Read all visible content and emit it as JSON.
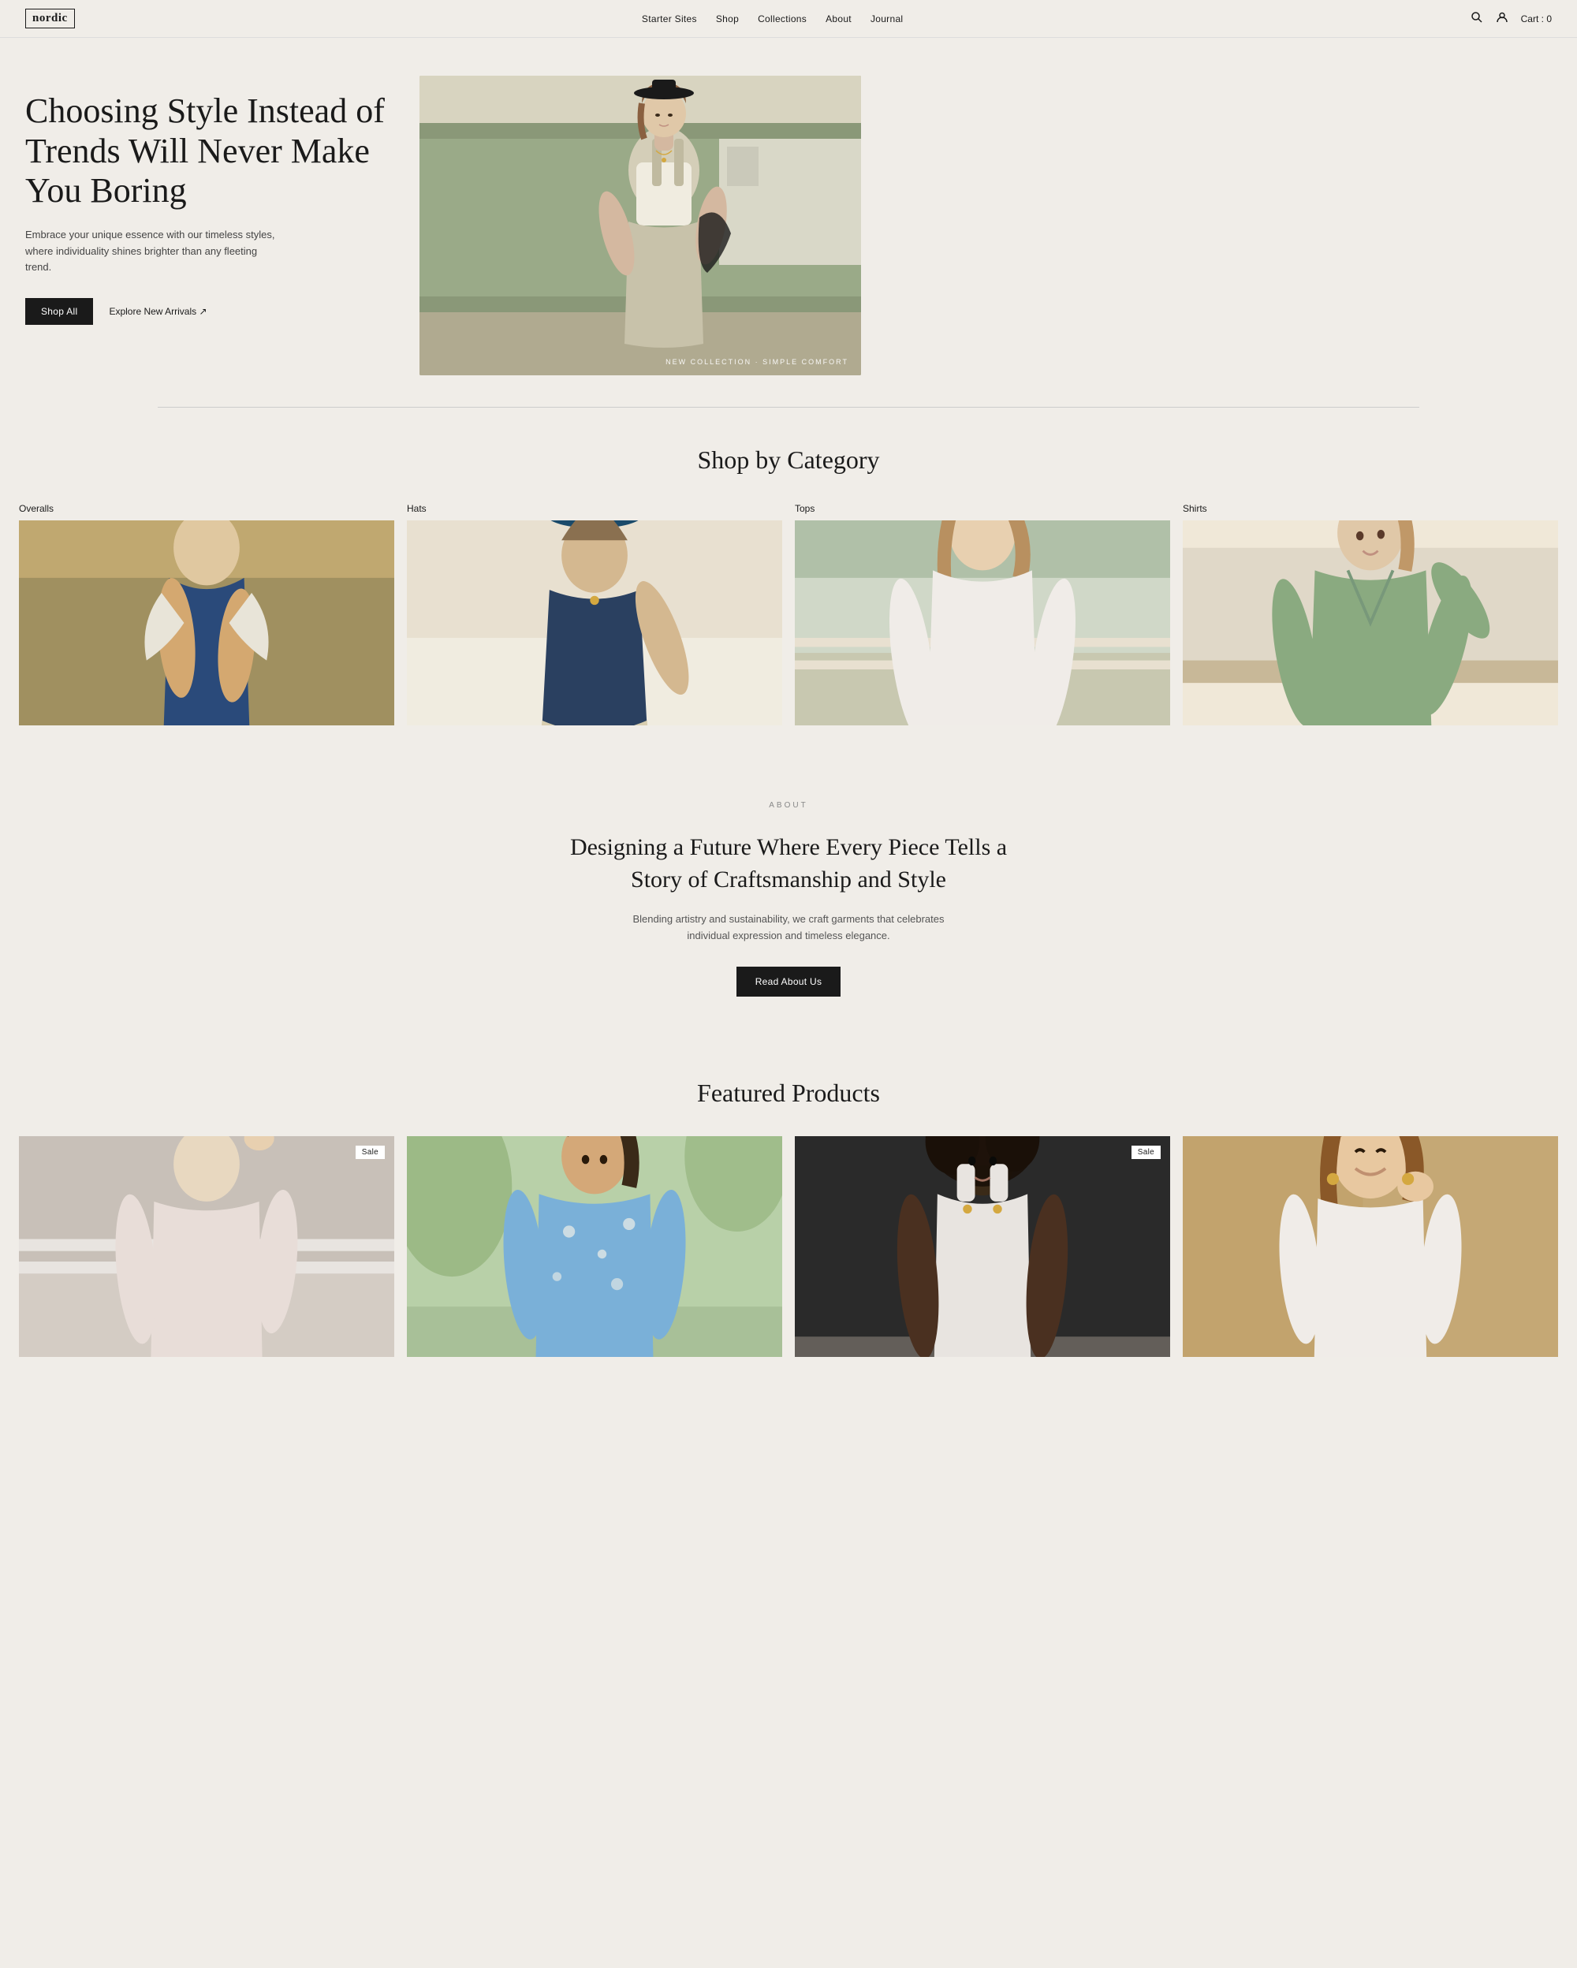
{
  "site": {
    "logo": "nordic",
    "logo_border": true
  },
  "nav": {
    "links": [
      {
        "label": "Starter Sites",
        "href": "#"
      },
      {
        "label": "Shop",
        "href": "#"
      },
      {
        "label": "Collections",
        "href": "#"
      },
      {
        "label": "About",
        "href": "#"
      },
      {
        "label": "Journal",
        "href": "#"
      }
    ],
    "cart_label": "Cart : 0"
  },
  "hero": {
    "heading": "Choosing Style Instead of Trends Will Never Make You Boring",
    "subtext": "Embrace your unique essence with our timeless styles, where individuality shines brighter than any fleeting trend.",
    "btn_shop_all": "Shop All",
    "btn_explore": "Explore New Arrivals ↗",
    "image_overlay": "NEW COLLECTION · SIMPLE COMFORT"
  },
  "shop_category": {
    "title": "Shop by Category",
    "categories": [
      {
        "label": "Overalls",
        "img_class": "cat-img-1"
      },
      {
        "label": "Hats",
        "img_class": "cat-img-2"
      },
      {
        "label": "Tops",
        "img_class": "cat-img-3"
      },
      {
        "label": "Shirts",
        "img_class": "cat-img-4"
      }
    ]
  },
  "about": {
    "label": "ABOUT",
    "heading": "Designing a Future Where Every Piece Tells a Story of Craftsmanship and Style",
    "subtext": "Blending artistry and sustainability, we craft garments that celebrates individual expression and timeless elegance.",
    "btn_label": "Read About Us"
  },
  "featured": {
    "title": "Featured Products",
    "products": [
      {
        "sale": true,
        "img_class": "prod-img-1"
      },
      {
        "sale": false,
        "img_class": "prod-img-2"
      },
      {
        "sale": true,
        "img_class": "prod-img-3"
      },
      {
        "sale": false,
        "img_class": "prod-img-4"
      }
    ]
  }
}
